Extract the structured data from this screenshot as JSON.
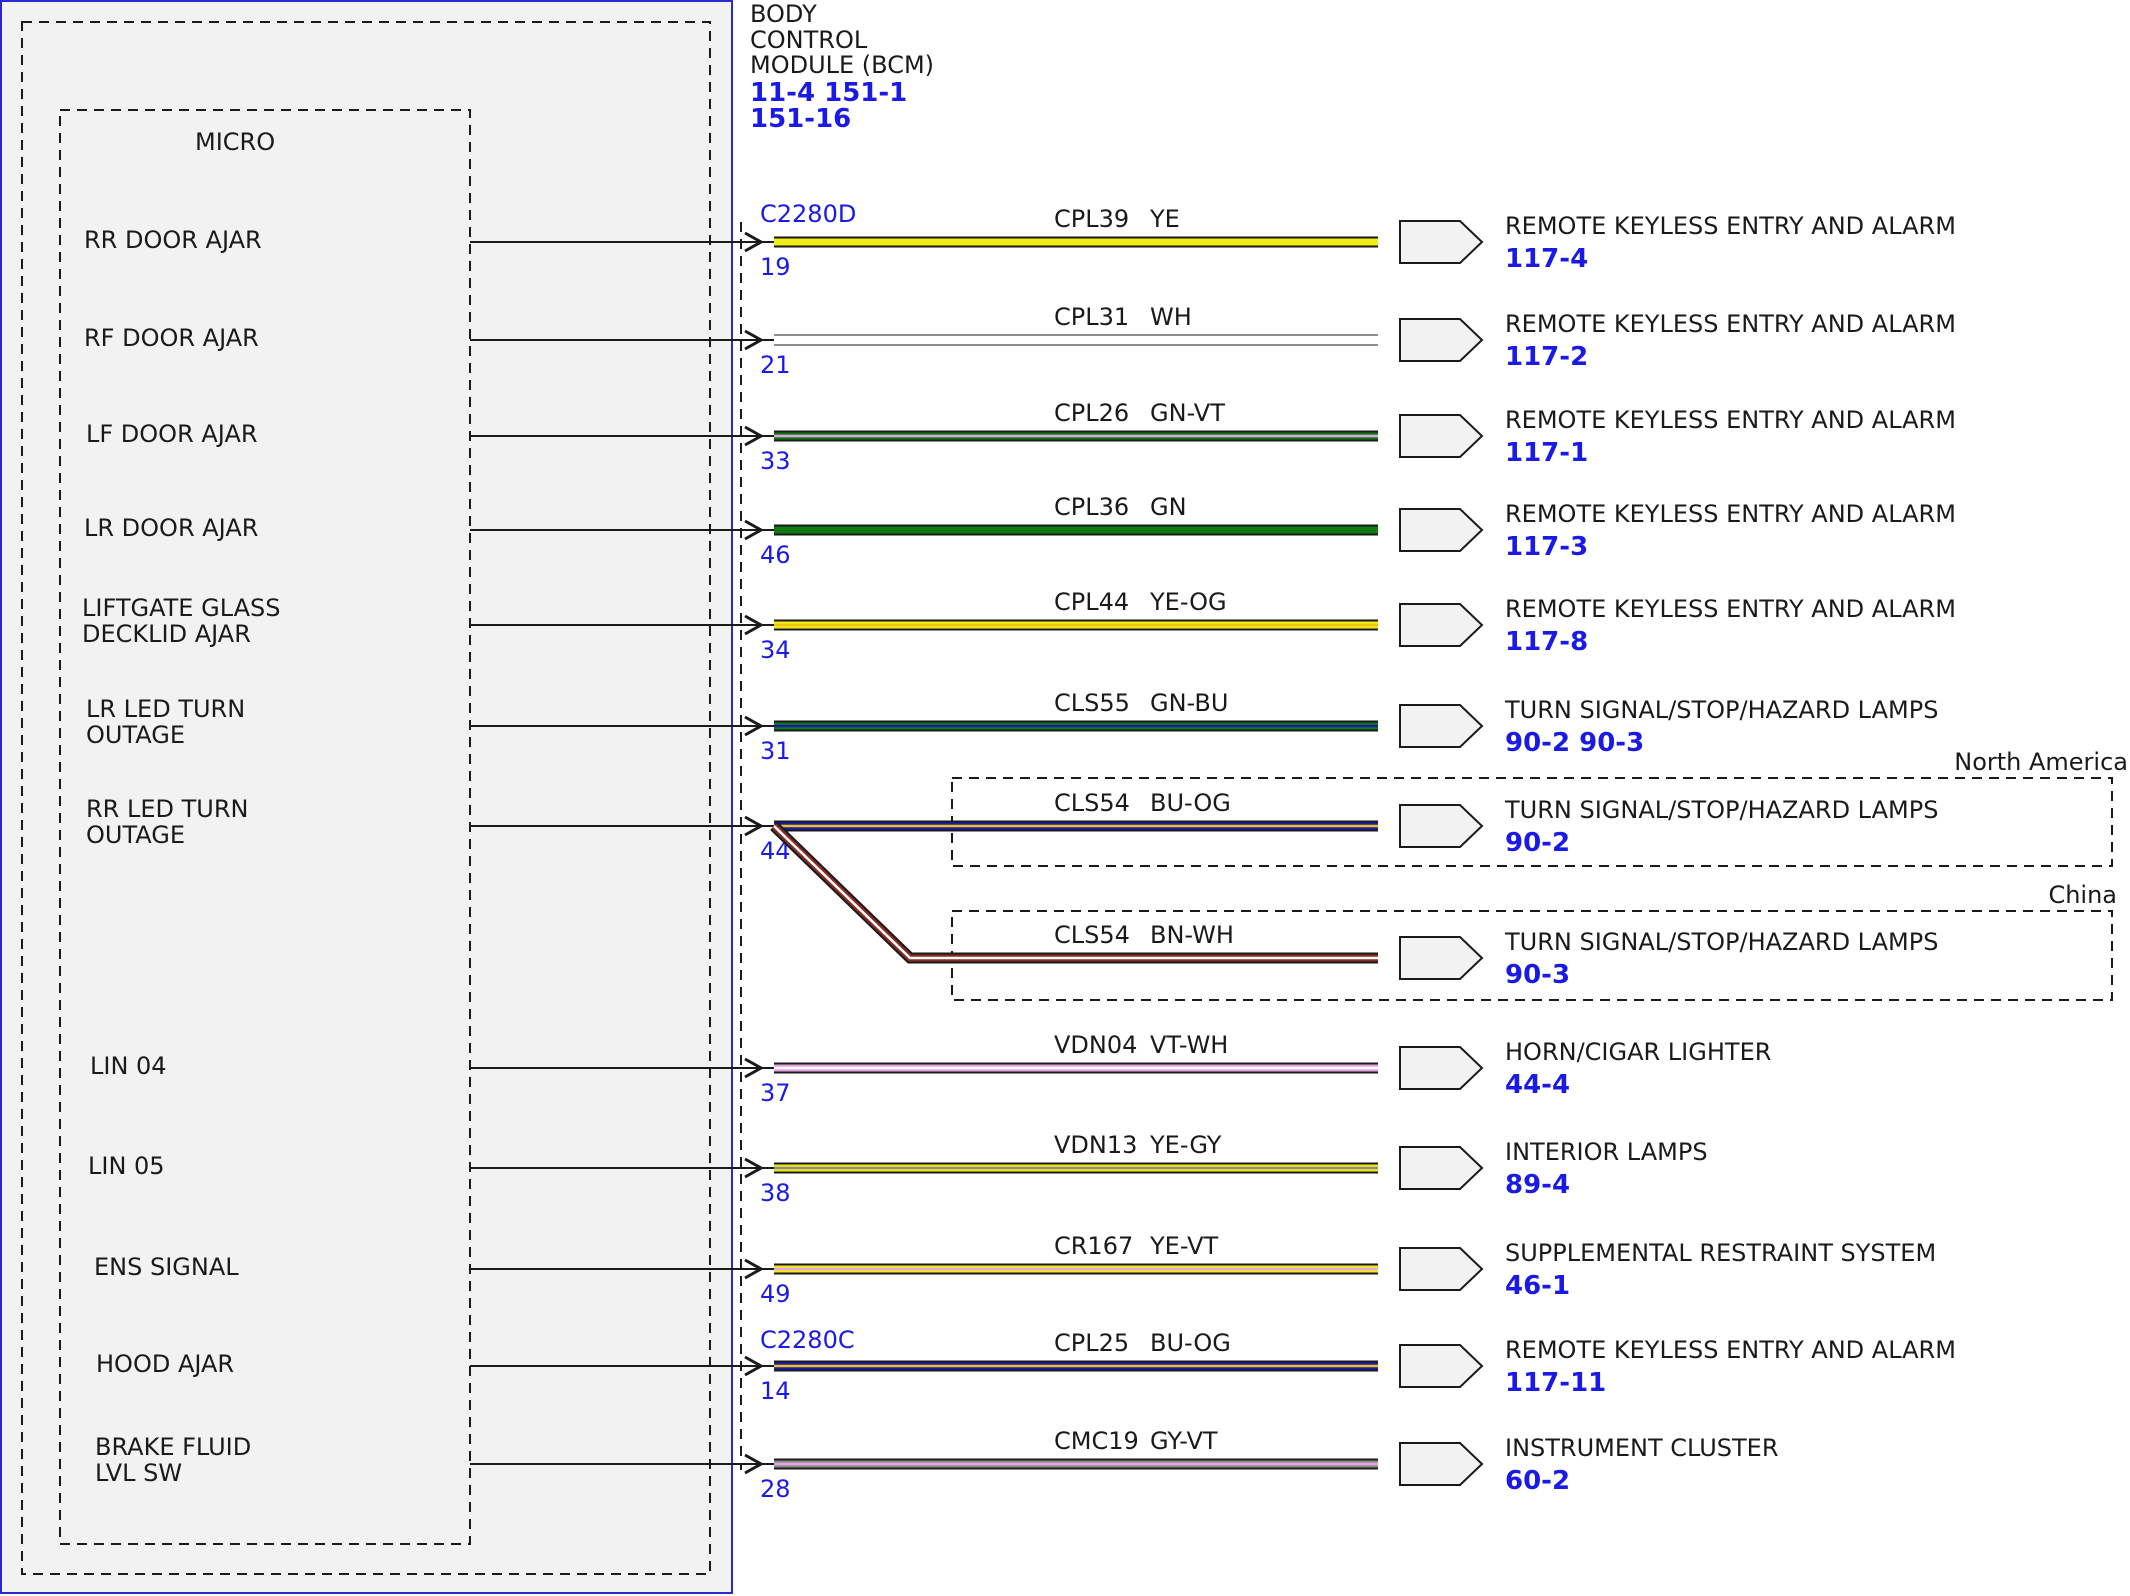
{
  "module": {
    "title_lines": [
      "BODY",
      "CONTROL",
      "MODULE (BCM)"
    ],
    "ref_lines": [
      "11-4  151-1",
      "151-16"
    ],
    "micro_label": "MICRO"
  },
  "connectors": [
    {
      "name": "C2280D"
    },
    {
      "name": "C2280C"
    }
  ],
  "regions": [
    {
      "label": "North America"
    },
    {
      "label": "China"
    }
  ],
  "colors": {
    "module_border": "#2a2ad0",
    "module_fill": "#f2f2f2",
    "pin_number": "#1a1ae6",
    "reference": "#1a1ae6",
    "text": "#1a1a1a",
    "YE": "#f0ec1a",
    "WH": "#ffffff",
    "GN": "#0f7a12",
    "VT": "#e6a3e6",
    "OG": "#f0c30e",
    "BU": "#1a1ab4",
    "BN": "#8a2a24",
    "GY": "#8c8c8c"
  },
  "circuits": [
    {
      "signal": [
        "RR DOOR AJAR"
      ],
      "pin": "19",
      "circuit": "CPL39",
      "color_code": "YE",
      "destination": "REMOTE KEYLESS ENTRY AND ALARM",
      "ref": "117-4"
    },
    {
      "signal": [
        "RF DOOR AJAR"
      ],
      "pin": "21",
      "circuit": "CPL31",
      "color_code": "WH",
      "destination": "REMOTE KEYLESS ENTRY AND ALARM",
      "ref": "117-2"
    },
    {
      "signal": [
        "LF DOOR AJAR"
      ],
      "pin": "33",
      "circuit": "CPL26",
      "color_code": "GN-VT",
      "destination": "REMOTE KEYLESS ENTRY AND ALARM",
      "ref": "117-1"
    },
    {
      "signal": [
        "LR DOOR AJAR"
      ],
      "pin": "46",
      "circuit": "CPL36",
      "color_code": "GN",
      "destination": "REMOTE KEYLESS ENTRY AND ALARM",
      "ref": "117-3"
    },
    {
      "signal": [
        "LIFTGATE GLASS",
        "DECKLID AJAR"
      ],
      "pin": "34",
      "circuit": "CPL44",
      "color_code": "YE-OG",
      "destination": "REMOTE KEYLESS ENTRY AND ALARM",
      "ref": "117-8"
    },
    {
      "signal": [
        "LR LED TURN",
        "OUTAGE"
      ],
      "pin": "31",
      "circuit": "CLS55",
      "color_code": "GN-BU",
      "destination": "TURN SIGNAL/STOP/HAZARD LAMPS",
      "ref": "90-2  90-3"
    },
    {
      "signal": [
        "RR LED TURN",
        "OUTAGE"
      ],
      "pin": "44",
      "circuit": "CLS54",
      "color_code": "BU-OG",
      "destination": "TURN SIGNAL/STOP/HAZARD LAMPS",
      "ref": "90-2"
    },
    {
      "signal": [],
      "pin": "",
      "circuit": "CLS54",
      "color_code": "BN-WH",
      "destination": "TURN SIGNAL/STOP/HAZARD LAMPS",
      "ref": "90-3"
    },
    {
      "signal": [
        "LIN 04"
      ],
      "pin": "37",
      "circuit": "VDN04",
      "color_code": "VT-WH",
      "destination": "HORN/CIGAR LIGHTER",
      "ref": "44-4"
    },
    {
      "signal": [
        "LIN 05"
      ],
      "pin": "38",
      "circuit": "VDN13",
      "color_code": "YE-GY",
      "destination": "INTERIOR LAMPS",
      "ref": "89-4"
    },
    {
      "signal": [
        "ENS SIGNAL"
      ],
      "pin": "49",
      "circuit": "CR167",
      "color_code": "YE-VT",
      "destination": "SUPPLEMENTAL RESTRAINT SYSTEM",
      "ref": "46-1"
    },
    {
      "signal": [
        "HOOD AJAR"
      ],
      "pin": "14",
      "circuit": "CPL25",
      "color_code": "BU-OG",
      "destination": "REMOTE KEYLESS ENTRY AND ALARM",
      "ref": "117-11"
    },
    {
      "signal": [
        "BRAKE FLUID",
        "LVL SW"
      ],
      "pin": "28",
      "circuit": "CMC19",
      "color_code": "GY-VT",
      "destination": "INSTRUMENT CLUSTER",
      "ref": "60-2"
    }
  ]
}
